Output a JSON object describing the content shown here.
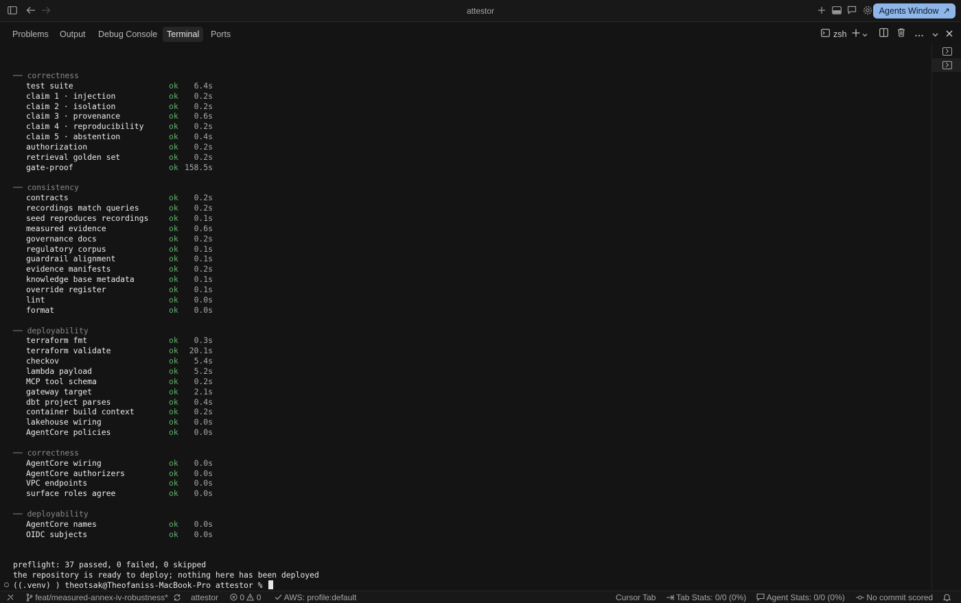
{
  "window": {
    "title": "attestor",
    "agents_label": "Agents Window",
    "agents_arrow": "↗"
  },
  "panel": {
    "tabs": [
      "Problems",
      "Output",
      "Debug Console",
      "Terminal",
      "Ports"
    ],
    "active_tab": "Terminal",
    "shell": "zsh"
  },
  "terminal": {
    "sections": [
      {
        "header": "── correctness",
        "items": [
          {
            "name": "test suite",
            "status": "ok",
            "time": "6.4s"
          },
          {
            "name": "claim 1 · injection",
            "status": "ok",
            "time": "0.2s"
          },
          {
            "name": "claim 2 · isolation",
            "status": "ok",
            "time": "0.2s"
          },
          {
            "name": "claim 3 · provenance",
            "status": "ok",
            "time": "0.6s"
          },
          {
            "name": "claim 4 · reproducibility",
            "status": "ok",
            "time": "0.2s"
          },
          {
            "name": "claim 5 · abstention",
            "status": "ok",
            "time": "0.4s"
          },
          {
            "name": "authorization",
            "status": "ok",
            "time": "0.2s"
          },
          {
            "name": "retrieval golden set",
            "status": "ok",
            "time": "0.2s"
          },
          {
            "name": "gate-proof",
            "status": "ok",
            "time": "158.5s"
          }
        ]
      },
      {
        "header": "── consistency",
        "items": [
          {
            "name": "contracts",
            "status": "ok",
            "time": "0.2s"
          },
          {
            "name": "recordings match queries",
            "status": "ok",
            "time": "0.2s"
          },
          {
            "name": "seed reproduces recordings",
            "status": "ok",
            "time": "0.1s"
          },
          {
            "name": "measured evidence",
            "status": "ok",
            "time": "0.6s"
          },
          {
            "name": "governance docs",
            "status": "ok",
            "time": "0.2s"
          },
          {
            "name": "regulatory corpus",
            "status": "ok",
            "time": "0.1s"
          },
          {
            "name": "guardrail alignment",
            "status": "ok",
            "time": "0.1s"
          },
          {
            "name": "evidence manifests",
            "status": "ok",
            "time": "0.2s"
          },
          {
            "name": "knowledge base metadata",
            "status": "ok",
            "time": "0.1s"
          },
          {
            "name": "override register",
            "status": "ok",
            "time": "0.1s"
          },
          {
            "name": "lint",
            "status": "ok",
            "time": "0.0s"
          },
          {
            "name": "format",
            "status": "ok",
            "time": "0.0s"
          }
        ]
      },
      {
        "header": "── deployability",
        "items": [
          {
            "name": "terraform fmt",
            "status": "ok",
            "time": "0.3s"
          },
          {
            "name": "terraform validate",
            "status": "ok",
            "time": "20.1s"
          },
          {
            "name": "checkov",
            "status": "ok",
            "time": "5.4s"
          },
          {
            "name": "lambda payload",
            "status": "ok",
            "time": "5.2s"
          },
          {
            "name": "MCP tool schema",
            "status": "ok",
            "time": "0.2s"
          },
          {
            "name": "gateway target",
            "status": "ok",
            "time": "2.1s"
          },
          {
            "name": "dbt project parses",
            "status": "ok",
            "time": "0.4s"
          },
          {
            "name": "container build context",
            "status": "ok",
            "time": "0.2s"
          },
          {
            "name": "lakehouse wiring",
            "status": "ok",
            "time": "0.0s"
          },
          {
            "name": "AgentCore policies",
            "status": "ok",
            "time": "0.0s"
          }
        ]
      },
      {
        "header": "── correctness",
        "items": [
          {
            "name": "AgentCore wiring",
            "status": "ok",
            "time": "0.0s"
          },
          {
            "name": "AgentCore authorizers",
            "status": "ok",
            "time": "0.0s"
          },
          {
            "name": "VPC endpoints",
            "status": "ok",
            "time": "0.0s"
          },
          {
            "name": "surface roles agree",
            "status": "ok",
            "time": "0.0s"
          }
        ]
      },
      {
        "header": "── deployability",
        "items": [
          {
            "name": "AgentCore names",
            "status": "ok",
            "time": "0.0s"
          },
          {
            "name": "OIDC subjects",
            "status": "ok",
            "time": "0.0s"
          }
        ]
      }
    ],
    "summary": "preflight: 37 passed, 0 failed, 0 skipped",
    "message": "the repository is ready to deploy; nothing here has been deployed",
    "prompt": "((.venv) ) theotsak@Theofaniss-MacBook-Pro attestor % "
  },
  "statusbar": {
    "branch": "feat/measured-annex-iv-robustness*",
    "repo": "attestor",
    "errors": "0",
    "warnings": "0",
    "aws": "AWS: profile:default",
    "cursor_tab": "Cursor Tab",
    "tab_stats": "Tab Stats: 0/0 (0%)",
    "agent_stats": "Agent Stats: 0/0 (0%)",
    "commit": "No commit scored"
  }
}
